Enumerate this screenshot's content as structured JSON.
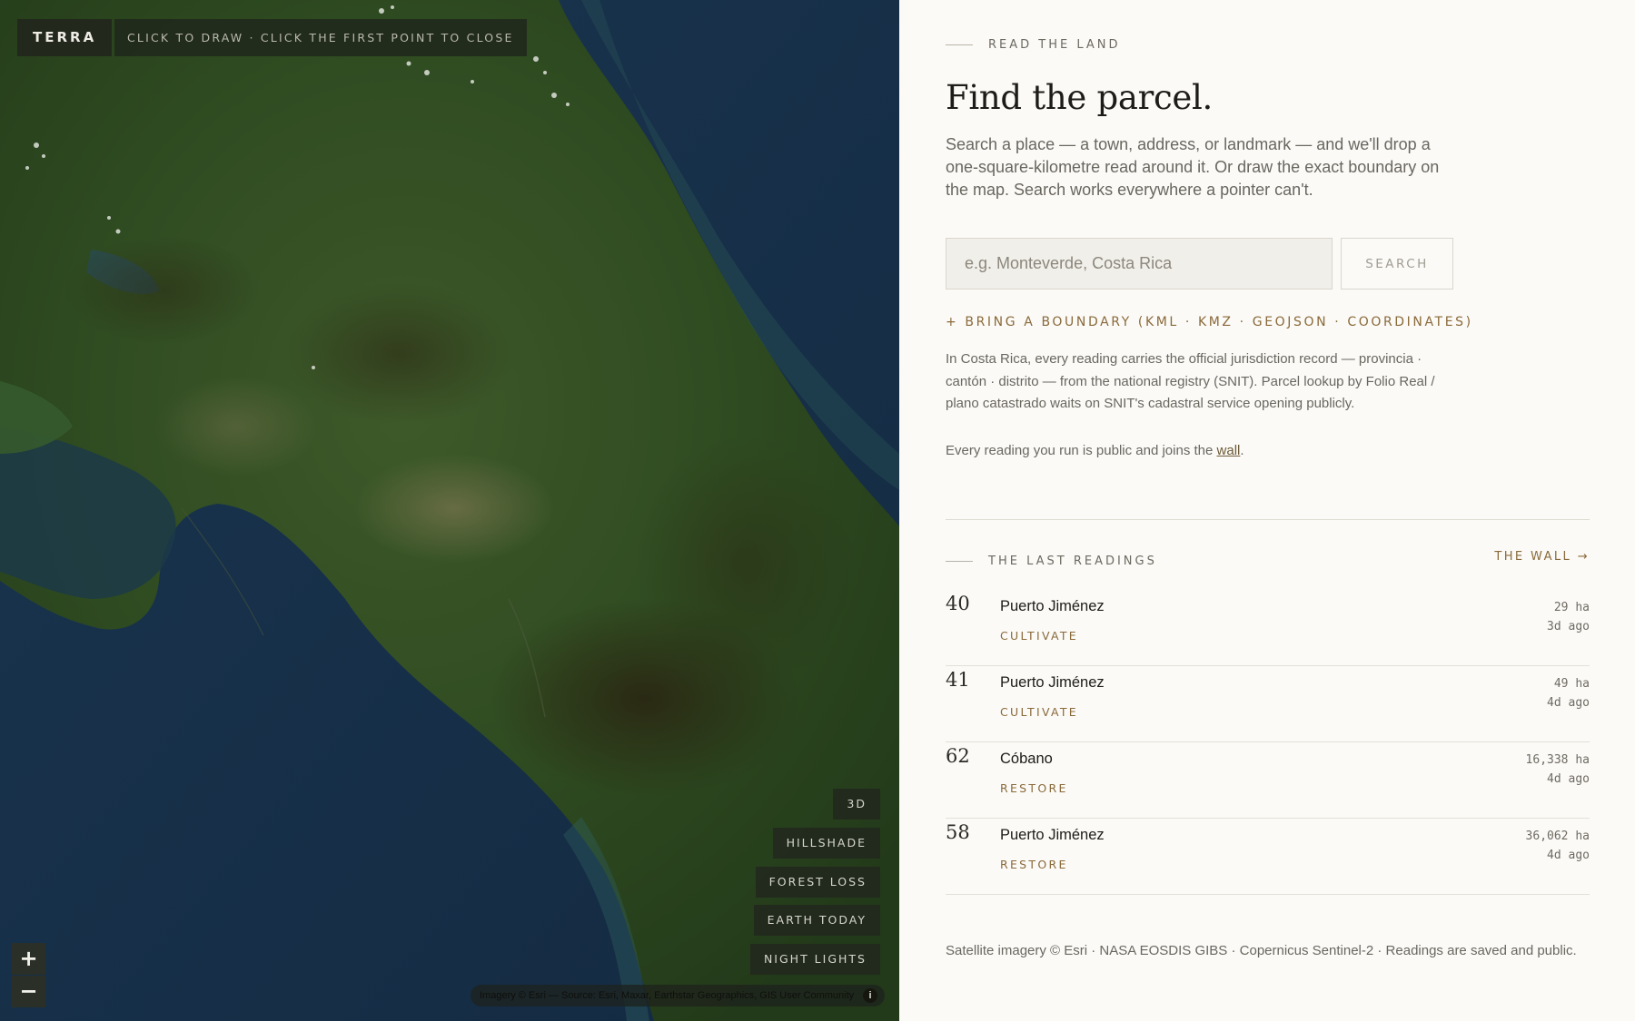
{
  "map": {
    "brand": "TERRA",
    "draw_hint": "CLICK TO DRAW · CLICK THE FIRST POINT TO CLOSE",
    "layers": [
      "3D",
      "HILLSHADE",
      "FOREST LOSS",
      "EARTH TODAY",
      "NIGHT LIGHTS"
    ],
    "zoom_in": "+",
    "zoom_out": "−",
    "attribution": "Imagery © Esri — Source: Esri, Maxar, Earthstar Geographics, GIS User Community",
    "info": "i"
  },
  "panel": {
    "eyebrow": "READ THE LAND",
    "title": "Find the parcel.",
    "intro": "Search a place — a town, address, or landmark — and we'll drop a one-square-kilometre read around it. Or draw the exact boundary on the map. Search works everywhere a pointer can't.",
    "search": {
      "placeholder": "e.g. Monteverde, Costa Rica",
      "button": "SEARCH"
    },
    "boundary_link": "+ BRING A BOUNDARY (KML · KMZ · GEOJSON · COORDINATES)",
    "jurisdiction": "In Costa Rica, every reading carries the official jurisdiction record — provincia · cantón · distrito — from the national registry (SNIT). Parcel lookup by Folio Real / plano catastrado waits on SNIT's cadastral service opening publicly.",
    "wall_note": {
      "before": "Every reading you run is public and joins the ",
      "link": "wall",
      "after": "."
    },
    "readings_heading": "THE LAST READINGS",
    "wall_link": "THE WALL →",
    "readings": [
      {
        "num": "40",
        "place": "Puerto Jiménez",
        "action": "CULTIVATE",
        "area": "29 ha",
        "ago": "3d ago"
      },
      {
        "num": "41",
        "place": "Puerto Jiménez",
        "action": "CULTIVATE",
        "area": "49 ha",
        "ago": "4d ago"
      },
      {
        "num": "62",
        "place": "Cóbano",
        "action": "RESTORE",
        "area": "16,338 ha",
        "ago": "4d ago"
      },
      {
        "num": "58",
        "place": "Puerto Jiménez",
        "action": "RESTORE",
        "area": "36,062 ha",
        "ago": "4d ago"
      }
    ],
    "footnote": "Satellite imagery © Esri · NASA EOSDIS GIBS · Copernicus Sentinel-2 · Readings are saved and public."
  },
  "colors": {
    "accent": "#8a6a3a",
    "ocean": "#17304a",
    "land": "#2f4a22"
  }
}
